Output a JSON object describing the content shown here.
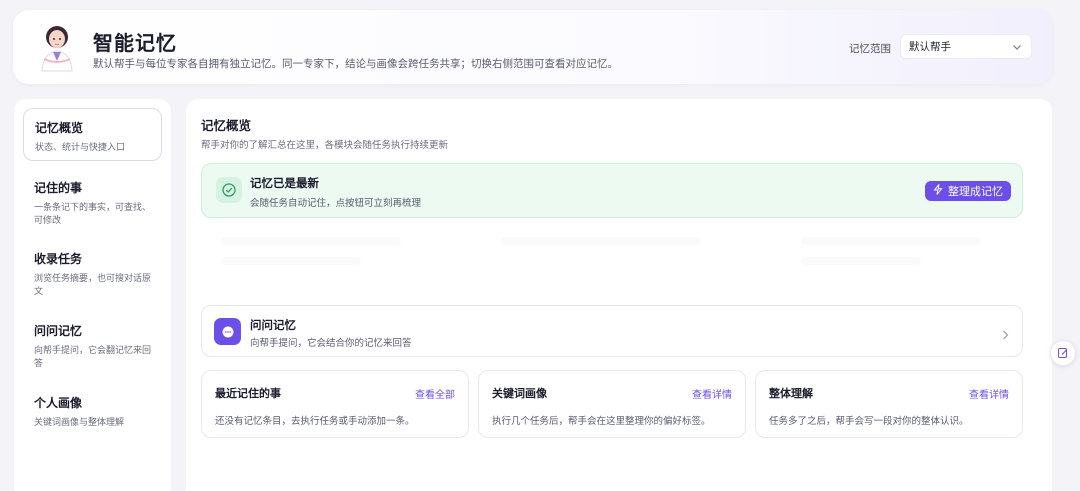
{
  "header": {
    "title": "智能记忆",
    "subtitle": "默认帮手与每位专家各自拥有独立记忆。同一专家下，结论与画像会跨任务共享；切换右侧范围可查看对应记忆。",
    "scope_label": "记忆范围",
    "scope_value": "默认帮手"
  },
  "sidebar": {
    "items": [
      {
        "title": "记忆概览",
        "desc": "状态、统计与快捷入口"
      },
      {
        "title": "记住的事",
        "desc": "一条条记下的事实，可查找、可修改"
      },
      {
        "title": "收录任务",
        "desc": "浏览任务摘要，也可搜对话原文"
      },
      {
        "title": "问问记忆",
        "desc": "向帮手提问，它会翻记忆来回答"
      },
      {
        "title": "个人画像",
        "desc": "关键词画像与整体理解"
      }
    ]
  },
  "main": {
    "title": "记忆概览",
    "subtitle": "帮手对你的了解汇总在这里，各模块会随任务执行持续更新",
    "status": {
      "title": "记忆已是最新",
      "desc": "会随任务自动记住，点按钮可立刻再梳理",
      "button": "整理成记忆"
    },
    "ask": {
      "title": "问问记忆",
      "desc": "向帮手提问，它会结合你的记忆来回答"
    },
    "cards": [
      {
        "title": "最近记住的事",
        "link": "查看全部",
        "desc": "还没有记忆条目，去执行任务或手动添加一条。"
      },
      {
        "title": "关键词画像",
        "link": "查看详情",
        "desc": "执行几个任务后，帮手会在这里整理你的偏好标签。"
      },
      {
        "title": "整体理解",
        "link": "查看详情",
        "desc": "任务多了之后，帮手会写一段对你的整体认识。"
      }
    ]
  },
  "colors": {
    "accent": "#6b4fe8",
    "success_bg": "#ecfaf2",
    "success_icon": "#2e9e5e"
  },
  "icons": [
    "avatar-assistant",
    "chevron-down-icon",
    "check-circle-icon",
    "lightning-icon",
    "chat-bubble-icon",
    "chevron-right-icon",
    "edit-icon"
  ]
}
